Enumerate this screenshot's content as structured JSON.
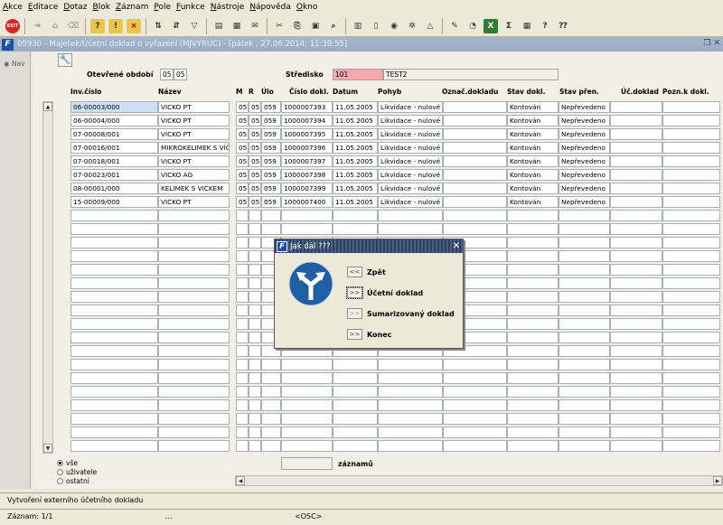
{
  "menu": [
    "Akce",
    "Editace",
    "Dotaz",
    "Blok",
    "Záznam",
    "Pole",
    "Funkce",
    "Nástroje",
    "Nápověda",
    "Okno"
  ],
  "toolbar": {
    "exit_label": "EXIT"
  },
  "window": {
    "title": "05930 - Majetek/Účetní doklad o vyřazení (MJVYRUC) - [pátek , 27.06.2014; 11:39:55]"
  },
  "nav": {
    "label": "Nav"
  },
  "header": {
    "period_label": "Otevřené období",
    "period_a": "05",
    "period_b": "05",
    "center_label": "Středisko",
    "center_code": "101",
    "center_name": "TEST2"
  },
  "columns": [
    "Inv.číslo",
    "Název",
    "M",
    "R",
    "Úlo",
    "Číslo dokl.",
    "Datum",
    "Pohyb",
    "Označ.dokladu",
    "Stav dokl.",
    "Stav přen.",
    "Úč.doklad",
    "Pozn.k dokl."
  ],
  "rows": [
    {
      "inv": "06-00003/000",
      "nazev": "VICKO PT",
      "m": "05",
      "r": "05",
      "ulo": "059",
      "cislo": "1000007393",
      "datum": "11.05.2005",
      "pohyb": "Likvidace - nulové",
      "oznac": "",
      "stav": "Kontován",
      "prenos": "Nepřevedeno",
      "ucdokl": "",
      "pozn": ""
    },
    {
      "inv": "06-00004/000",
      "nazev": "VICKO PT",
      "m": "05",
      "r": "05",
      "ulo": "059",
      "cislo": "1000007394",
      "datum": "11.05.2005",
      "pohyb": "Likvidace - nulové",
      "oznac": "",
      "stav": "Kontován",
      "prenos": "Nepřevedeno",
      "ucdokl": "",
      "pozn": ""
    },
    {
      "inv": "07-00008/001",
      "nazev": "VICKO PT",
      "m": "05",
      "r": "05",
      "ulo": "059",
      "cislo": "1000007395",
      "datum": "11.05.2005",
      "pohyb": "Likvidace - nulové",
      "oznac": "",
      "stav": "Kontován",
      "prenos": "Nepřevedeno",
      "ucdokl": "",
      "pozn": ""
    },
    {
      "inv": "07-00016/001",
      "nazev": "MIKROKELIMEK S VÍČKEM",
      "m": "05",
      "r": "05",
      "ulo": "059",
      "cislo": "1000007396",
      "datum": "11.05.2005",
      "pohyb": "Likvidace - nulové",
      "oznac": "",
      "stav": "Kontován",
      "prenos": "Nepřevedeno",
      "ucdokl": "",
      "pozn": ""
    },
    {
      "inv": "07-00018/001",
      "nazev": "VICKO PT",
      "m": "05",
      "r": "05",
      "ulo": "059",
      "cislo": "1000007397",
      "datum": "11.05.2005",
      "pohyb": "Likvidace - nulové",
      "oznac": "",
      "stav": "Kontován",
      "prenos": "Nepřevedeno",
      "ucdokl": "",
      "pozn": ""
    },
    {
      "inv": "07-00023/001",
      "nazev": "VICKO AG",
      "m": "05",
      "r": "05",
      "ulo": "059",
      "cislo": "1000007398",
      "datum": "11.05.2005",
      "pohyb": "Likvidace - nulové",
      "oznac": "",
      "stav": "Kontován",
      "prenos": "Nepřevedeno",
      "ucdokl": "",
      "pozn": ""
    },
    {
      "inv": "08-00001/000",
      "nazev": "KELIMEK S VICKEM",
      "m": "05",
      "r": "05",
      "ulo": "059",
      "cislo": "1000007399",
      "datum": "11.05.2005",
      "pohyb": "Likvidace - nulové",
      "oznac": "",
      "stav": "Kontován",
      "prenos": "Nepřevedeno",
      "ucdokl": "",
      "pozn": ""
    },
    {
      "inv": "15-00009/000",
      "nazev": "VICKO PT",
      "m": "05",
      "r": "05",
      "ulo": "059",
      "cislo": "1000007400",
      "datum": "11.05.2005",
      "pohyb": "Likvidace - nulové",
      "oznac": "",
      "stav": "Kontován",
      "prenos": "Nepřevedeno",
      "ucdokl": "",
      "pozn": ""
    }
  ],
  "footer": {
    "radios": [
      "vše",
      "uživatele",
      "ostatní"
    ],
    "selected_radio": "vše",
    "count_label": "záznamů",
    "count_value": ""
  },
  "dialog": {
    "title": "Jak dál ???",
    "icon": "road-fork-sign-icon",
    "icon_color": "#1f5fa8",
    "buttons": [
      {
        "symbol": "<<",
        "label": "Zpět"
      },
      {
        "symbol": ">>",
        "label": "Účetní doklad"
      },
      {
        "symbol": ">>",
        "label": "Sumarizovaný doklad"
      },
      {
        "symbol": ">>",
        "label": "Konec"
      }
    ]
  },
  "status": {
    "message": "Vytvoření externího účetního dokladu",
    "record": "Záznam: 1/1",
    "dots": "...",
    "osc": "<OSC>"
  }
}
